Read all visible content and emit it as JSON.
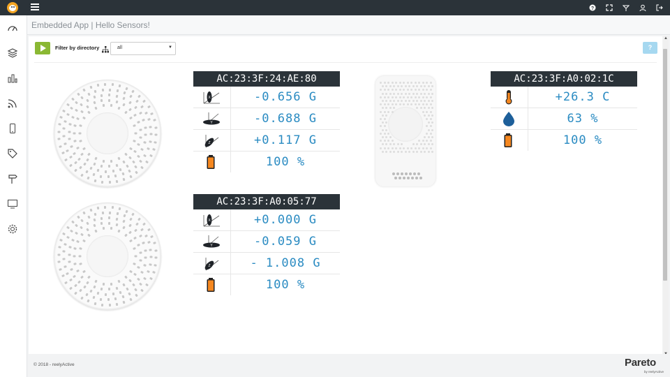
{
  "app": {
    "title": "Embedded App | Hello Sensors!"
  },
  "toolbar": {
    "filter_label": "Filter by directory",
    "filter_value": "all",
    "help_label": "?"
  },
  "footer": {
    "copyright": "© 2018 - reelyActive",
    "brand": "Pareto",
    "brand_sub": "by reelyActive"
  },
  "sidebar": {
    "items": [
      {
        "icon": "dashboard-icon"
      },
      {
        "icon": "layers-icon"
      },
      {
        "icon": "bar-chart-icon"
      },
      {
        "icon": "rss-icon"
      },
      {
        "icon": "mobile-icon"
      },
      {
        "icon": "tags-icon"
      },
      {
        "icon": "signpost-icon"
      },
      {
        "icon": "monitor-icon"
      },
      {
        "icon": "settings-icon"
      }
    ]
  },
  "topbar": {
    "icons": [
      "help-icon",
      "fullscreen-icon",
      "antenna-icon",
      "user-icon",
      "logout-icon"
    ]
  },
  "sensors": [
    {
      "id": "AC:23:3F:24:AE:80",
      "rows": [
        {
          "icon": "accelerometer-x-icon",
          "value": "-0.656 G"
        },
        {
          "icon": "accelerometer-y-icon",
          "value": "-0.688 G"
        },
        {
          "icon": "accelerometer-z-icon",
          "value": "+0.117 G"
        },
        {
          "icon": "battery-icon",
          "value": "100 %"
        }
      ]
    },
    {
      "id": "AC:23:3F:A0:05:77",
      "rows": [
        {
          "icon": "accelerometer-x-icon",
          "value": "+0.000 G"
        },
        {
          "icon": "accelerometer-y-icon",
          "value": "-0.059 G"
        },
        {
          "icon": "accelerometer-z-icon",
          "value": "- 1.008 G"
        },
        {
          "icon": "battery-icon",
          "value": "100 %"
        }
      ]
    },
    {
      "id": "AC:23:3F:A0:02:1C",
      "rows": [
        {
          "icon": "thermometer-icon",
          "value": "+26.3 C"
        },
        {
          "icon": "humidity-drop-icon",
          "value": "63 %"
        },
        {
          "icon": "battery-icon",
          "value": "100 %"
        }
      ]
    }
  ],
  "colors": {
    "topbar": "#2b3339",
    "reading": "#2a8bc2",
    "accent": "#f5871f",
    "play": "#8ab833",
    "help": "#a6d8f0"
  }
}
